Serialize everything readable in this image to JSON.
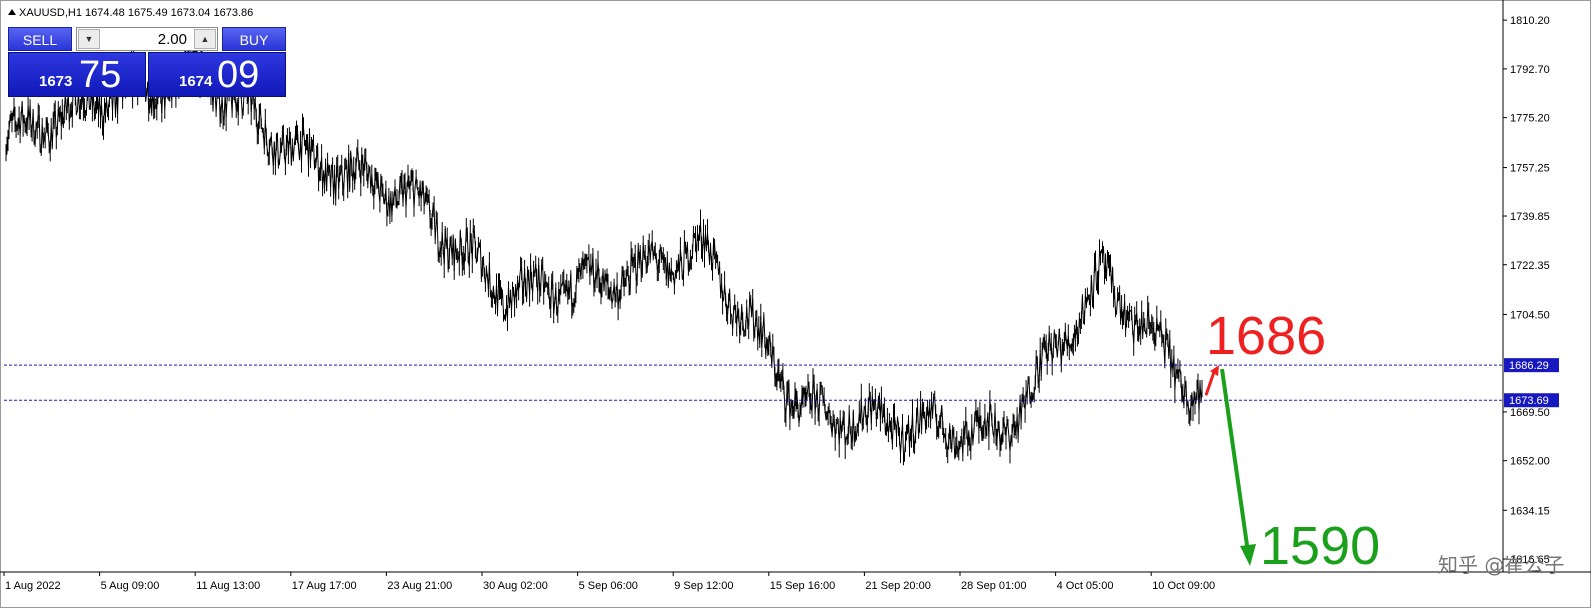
{
  "window": {
    "symbol_line": "XAUUSD,H1  1674.48 1675.49 1673.04 1673.86"
  },
  "trade_panel": {
    "sell_label": "SELL",
    "buy_label": "BUY",
    "lot_value": "2.00",
    "sell_price_big": "1673",
    "sell_price_pips": "75",
    "buy_price_big": "1674",
    "buy_price_pips": "09"
  },
  "price_axis": {
    "ticks": [
      "1810.20",
      "1792.70",
      "1775.20",
      "1757.25",
      "1739.85",
      "1722.35",
      "1704.50",
      "1669.50",
      "1652.00",
      "1634.15",
      "1616.65"
    ],
    "tick_values": [
      1810.2,
      1792.7,
      1775.2,
      1757.25,
      1739.85,
      1722.35,
      1704.5,
      1669.5,
      1652.0,
      1634.15,
      1616.65
    ],
    "range": [
      1612,
      1816
    ],
    "labels": [
      {
        "text": "1686.29",
        "value": 1686.29,
        "color": "#1818c0"
      },
      {
        "text": "1673.69",
        "value": 1673.69,
        "color": "#1818c0"
      }
    ]
  },
  "time_axis": {
    "labels": [
      "1 Aug 2022",
      "5 Aug 09:00",
      "11 Aug 13:00",
      "17 Aug 17:00",
      "23 Aug 21:00",
      "30 Aug 02:00",
      "5 Sep 06:00",
      "9 Sep 12:00",
      "15 Sep 16:00",
      "21 Sep 20:00",
      "28 Sep 01:00",
      "4 Oct 05:00",
      "10 Oct 09:00"
    ]
  },
  "annotations": {
    "up_target": "1686",
    "down_target": "1590",
    "up_color": "#ee2020",
    "down_color": "#1aa01a"
  },
  "watermark": "知乎 @崔公子",
  "chart_data": {
    "type": "line",
    "title": "",
    "x": [
      "1 Aug 2022",
      "5 Aug 09:00",
      "11 Aug 13:00",
      "17 Aug 17:00",
      "23 Aug 21:00",
      "30 Aug 02:00",
      "5 Sep 06:00",
      "9 Sep 12:00",
      "15 Sep 16:00",
      "21 Sep 20:00",
      "28 Sep 01:00",
      "4 Oct 05:00",
      "10 Oct 09:00"
    ],
    "series": [
      {
        "values": [
          1768,
          1782,
          1790,
          1760,
          1748,
          1712,
          1716,
          1728,
          1670,
          1665,
          1662,
          1718,
          1673.86
        ]
      }
    ],
    "xlabel": "",
    "ylabel": "",
    "ylim": [
      1612,
      1816
    ],
    "grid": false,
    "horizontal_levels": [
      1686.29,
      1673.69
    ]
  }
}
